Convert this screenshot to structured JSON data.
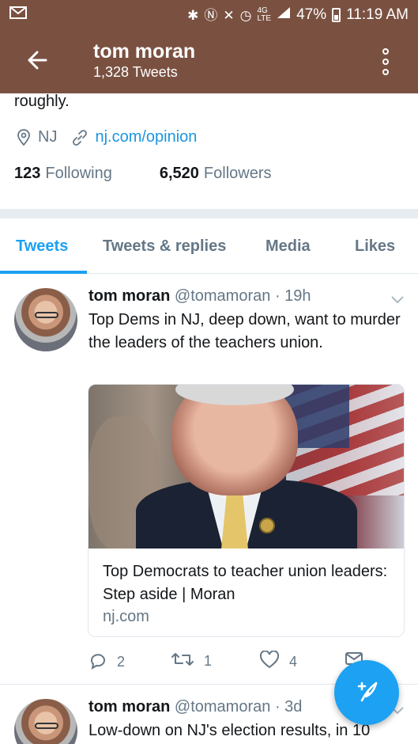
{
  "status_bar": {
    "left_icon": "gmail-icon",
    "icons": [
      "bluetooth-icon",
      "nfc-icon",
      "mute-icon",
      "alarm-icon",
      "4g-lte-icon",
      "signal-icon"
    ],
    "battery": "47%",
    "time": "11:19 AM"
  },
  "header": {
    "name": "tom moran",
    "tweet_count": "1,328 Tweets",
    "back_icon": "back-arrow-icon",
    "menu_icon": "overflow-menu-icon",
    "bg_color": "#7a5141"
  },
  "profile": {
    "bio_tail": "roughly.",
    "location": "NJ",
    "website": "nj.com/opinion",
    "following_count": "123",
    "following_label": "Following",
    "followers_count": "6,520",
    "followers_label": "Followers"
  },
  "tabs": [
    {
      "label": "Tweets",
      "active": true
    },
    {
      "label": "Tweets & replies",
      "active": false
    },
    {
      "label": "Media",
      "active": false
    },
    {
      "label": "Likes",
      "active": false
    }
  ],
  "tweets": [
    {
      "name": "tom moran",
      "handle": "@tomamoran",
      "time": "· 19h",
      "text": "Top Dems in NJ, deep down, want to murder the leaders of the teachers union.",
      "card": {
        "title": "Top Democrats to teacher union leaders: Step aside | Moran",
        "domain": "nj.com"
      },
      "actions": {
        "replies": "2",
        "retweets": "1",
        "likes": "4"
      }
    },
    {
      "name": "tom moran",
      "handle": "@tomamoran",
      "time": "· 3d",
      "text": "Low-down on NJ's election results, in 10"
    }
  ],
  "accent_color": "#1da1f2",
  "fab_icon": "compose-tweet-icon"
}
